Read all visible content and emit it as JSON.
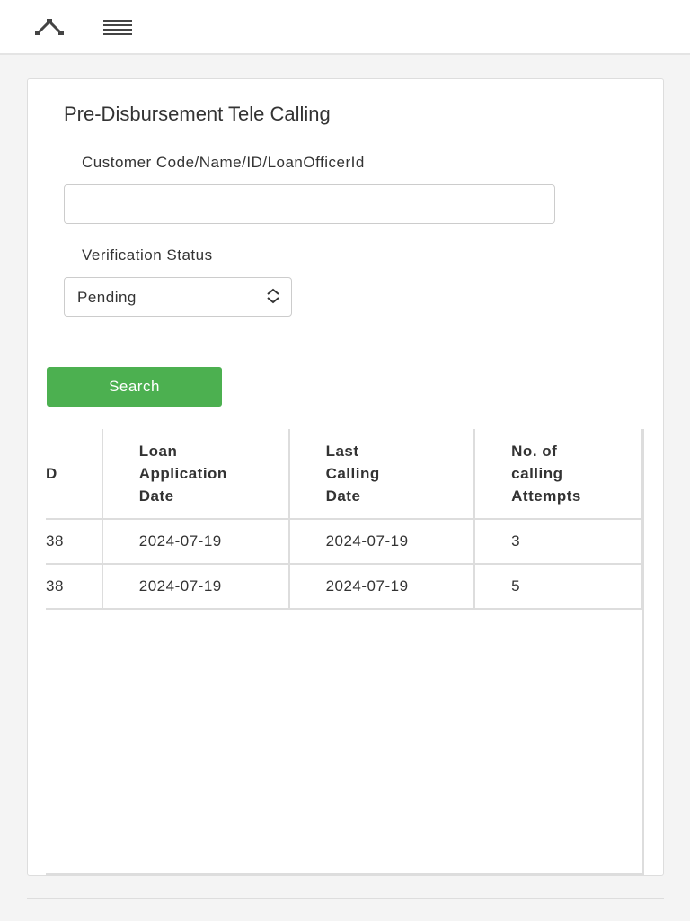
{
  "topbar": {
    "icons": [
      "collapse-up-icon",
      "menu-icon"
    ]
  },
  "page": {
    "title": "Pre-Disbursement Tele Calling",
    "search_label": "Customer Code/Name/ID/LoanOfficerId",
    "search_value": "",
    "status_label": "Verification Status",
    "status_value": "Pending",
    "search_button": "Search"
  },
  "table": {
    "headers": [
      "D",
      "Loan\nApplication\nDate",
      "Last\nCalling\nDate",
      "No. of\ncalling\nAttempts"
    ],
    "rows": [
      [
        "38",
        "2024-07-19",
        "2024-07-19",
        "3"
      ],
      [
        "38",
        "2024-07-19",
        "2024-07-19",
        "5"
      ]
    ]
  }
}
